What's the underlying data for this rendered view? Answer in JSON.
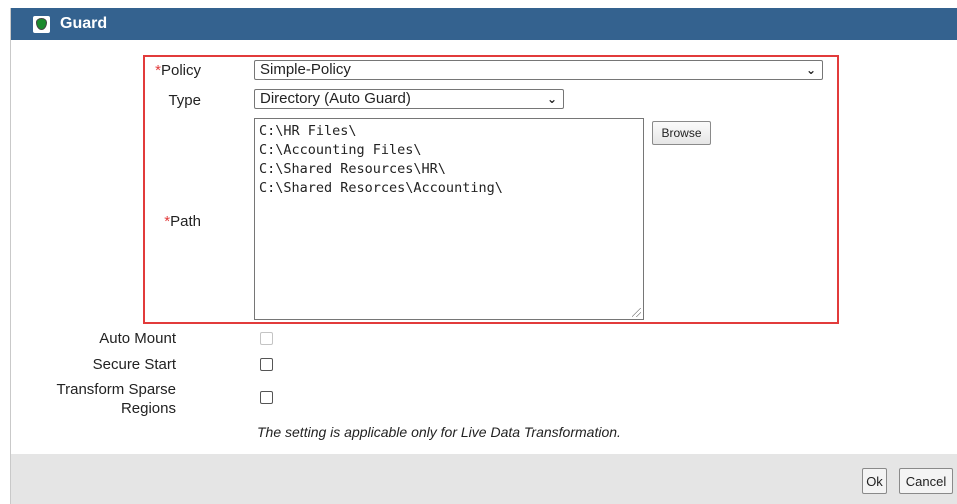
{
  "dialog": {
    "title": "Guard",
    "icon": "shield-icon"
  },
  "form": {
    "policy": {
      "required_mark": "*",
      "label": "Policy",
      "value": "Simple-Policy"
    },
    "type": {
      "label": "Type",
      "value": "Directory (Auto Guard)"
    },
    "path": {
      "required_mark": "*",
      "label": "Path",
      "lines": [
        "C:\\HR Files\\",
        "C:\\Accounting Files\\",
        "C:\\Shared Resources\\HR\\",
        "C:\\Shared Resorces\\Accounting\\"
      ],
      "browse_label": "Browse"
    },
    "auto_mount": {
      "label": "Auto Mount",
      "checked": false,
      "disabled": true
    },
    "secure_start": {
      "label": "Secure Start",
      "checked": false
    },
    "transform_sparse": {
      "label_line1": "Transform Sparse",
      "label_line2": "Regions",
      "checked": false
    },
    "note": "The setting is applicable only for Live Data Transformation."
  },
  "footer": {
    "ok_label": "Ok",
    "cancel_label": "Cancel"
  },
  "colors": {
    "titlebar": "#34628f",
    "highlight_border": "#e23b3b",
    "required": "#e23b3b",
    "footer_bg": "#e5e5e5"
  }
}
